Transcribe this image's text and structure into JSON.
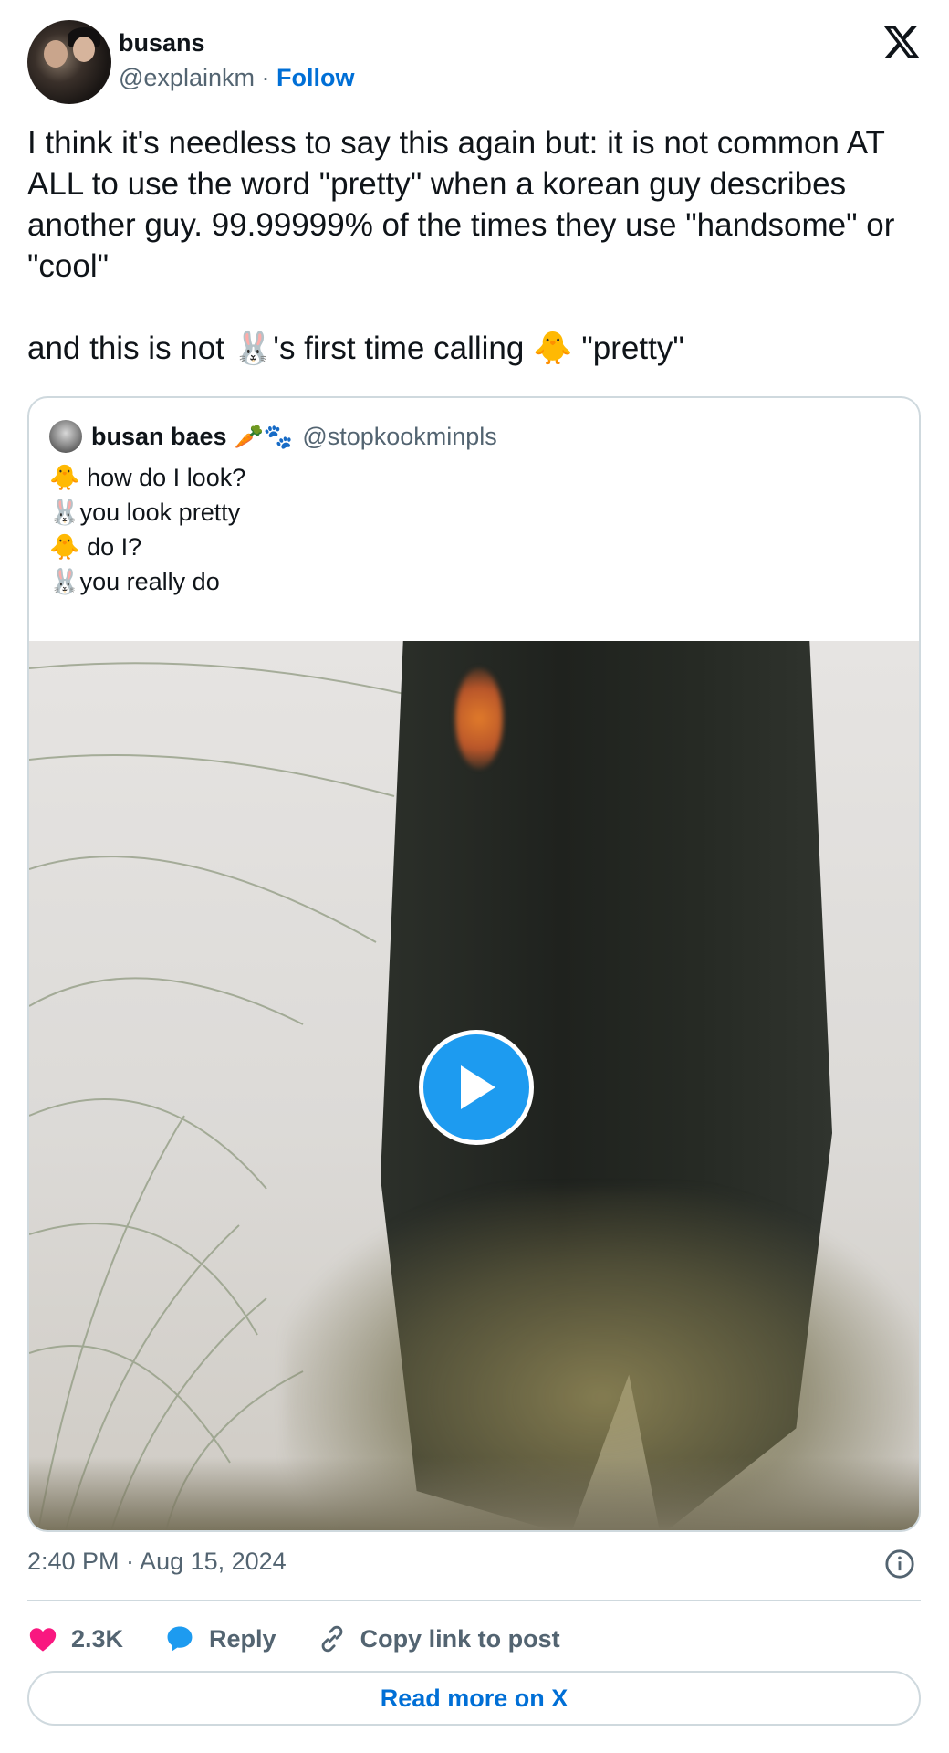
{
  "author": {
    "name": "busans",
    "handle": "@explainkm",
    "separator": " · ",
    "follow_label": "Follow"
  },
  "tweet": {
    "text": "I think it's needless to say this again but: it is not common AT ALL to use the word \"pretty\" when a korean guy describes another guy. 99.99999% of the times they use \"handsome\" or \"cool\"\n\nand this is not 🐰's first time calling 🐥 \"pretty\""
  },
  "quoted": {
    "name": "busan baes",
    "badges": "🥕🐾",
    "handle": "@stopkookminpls",
    "lines": [
      "🐥 how do I look?",
      "🐰you look pretty",
      "🐥 do I?",
      "🐰you really do"
    ]
  },
  "meta": {
    "timestamp": "2:40 PM · Aug 15, 2024"
  },
  "actions": {
    "likes": "2.3K",
    "reply_label": "Reply",
    "copy_label": "Copy link to post"
  },
  "footer": {
    "read_more_label": "Read more on X"
  },
  "colors": {
    "accent": "#1d9bf0",
    "link": "#006fd6",
    "heart": "#f91880",
    "muted": "#536471",
    "border": "#cfd9de"
  },
  "icons": [
    "x-logo-icon",
    "play-icon",
    "info-icon",
    "heart-icon",
    "reply-bubble-icon",
    "link-icon"
  ]
}
